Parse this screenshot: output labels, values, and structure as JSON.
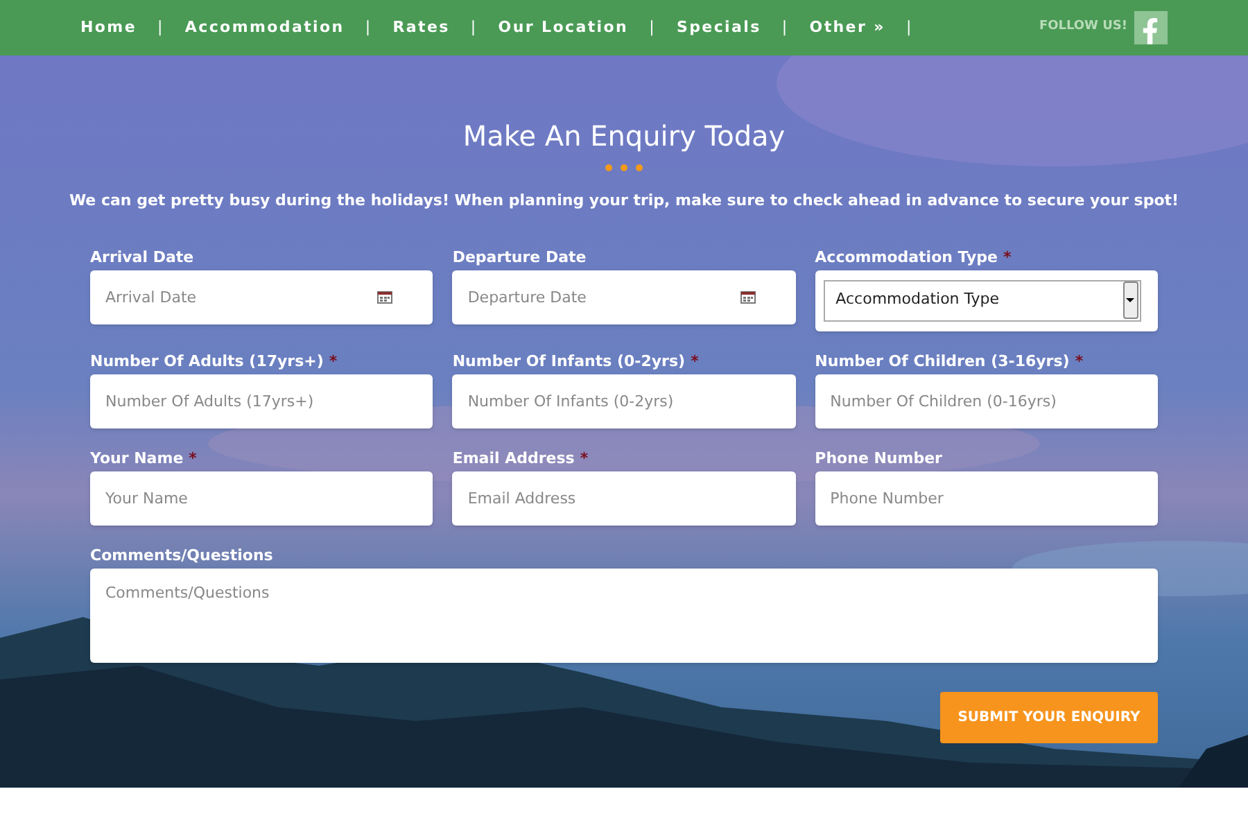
{
  "nav": {
    "items": [
      {
        "label": "Home"
      },
      {
        "label": "Accommodation"
      },
      {
        "label": "Rates"
      },
      {
        "label": "Our Location"
      },
      {
        "label": "Specials"
      },
      {
        "label": "Other »"
      }
    ],
    "separator": "|"
  },
  "social": {
    "label": "FOLLOW US!"
  },
  "heading": "Make An Enquiry Today",
  "intro": "We can get pretty busy during the holidays! When planning your trip, make sure to check ahead in advance to secure your spot!",
  "required_mark": "*",
  "fields": [
    {
      "kind": "date",
      "label": "Arrival Date",
      "required": false,
      "placeholder": "Arrival Date"
    },
    {
      "kind": "date",
      "label": "Departure Date",
      "required": false,
      "placeholder": "Departure Date"
    },
    {
      "kind": "select",
      "label": "Accommodation Type",
      "required": true,
      "value": "Accommodation Type"
    },
    {
      "kind": "text",
      "label": "Number Of Adults (17yrs+)",
      "required": true,
      "placeholder": "Number Of Adults (17yrs+)"
    },
    {
      "kind": "text",
      "label": "Number Of Infants (0-2yrs)",
      "required": true,
      "placeholder": "Number Of Infants (0-2yrs)"
    },
    {
      "kind": "text",
      "label": "Number Of Children (3-16yrs)",
      "required": true,
      "placeholder": "Number Of Children (0-16yrs)"
    },
    {
      "kind": "text",
      "label": "Your Name",
      "required": true,
      "placeholder": "Your Name"
    },
    {
      "kind": "text",
      "label": "Email Address",
      "required": true,
      "placeholder": "Email Address"
    },
    {
      "kind": "text",
      "label": "Phone Number",
      "required": false,
      "placeholder": "Phone Number"
    },
    {
      "kind": "textarea",
      "label": "Comments/Questions",
      "required": false,
      "placeholder": "Comments/Questions"
    }
  ],
  "submit": "SUBMIT YOUR ENQUIRY"
}
